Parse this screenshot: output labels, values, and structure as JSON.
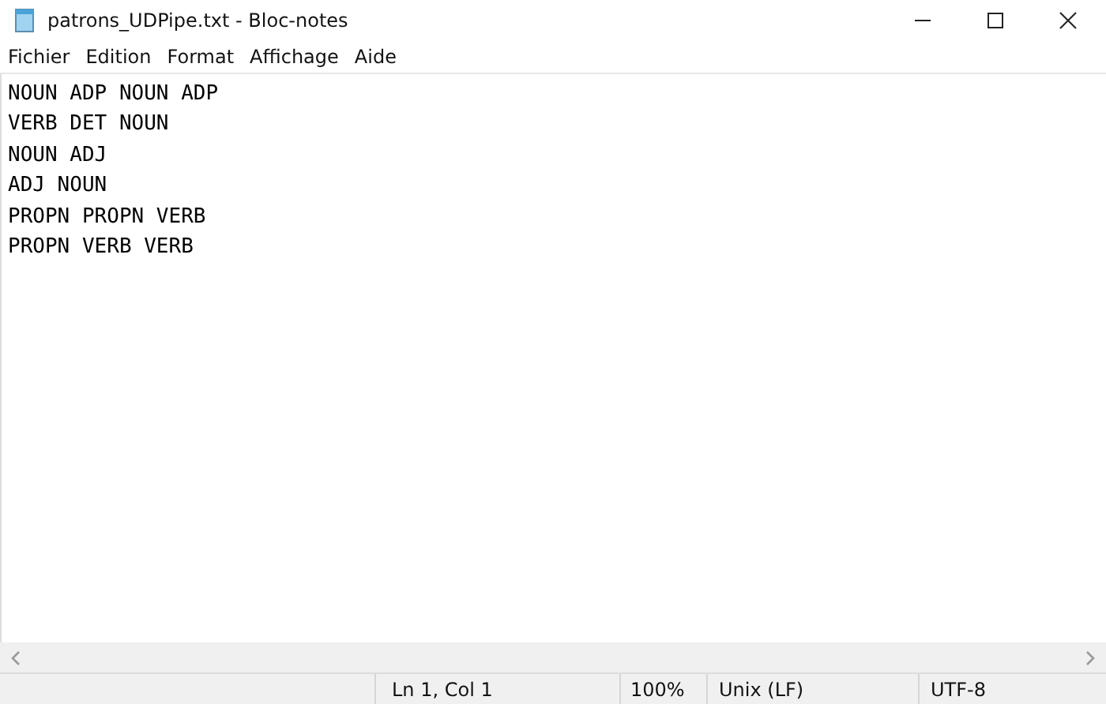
{
  "window": {
    "title": "patrons_UDPipe.txt - Bloc-notes"
  },
  "menu": [
    "Fichier",
    "Edition",
    "Format",
    "Affichage",
    "Aide"
  ],
  "editor": {
    "lines": [
      "NOUN ADP NOUN ADP",
      "VERB DET NOUN",
      "NOUN ADJ",
      "ADJ NOUN",
      "PROPN PROPN VERB",
      "PROPN VERB VERB"
    ]
  },
  "status_bar": [
    "Ln 1, Col 1",
    "100%",
    "Unix (LF)",
    "UTF-8"
  ]
}
